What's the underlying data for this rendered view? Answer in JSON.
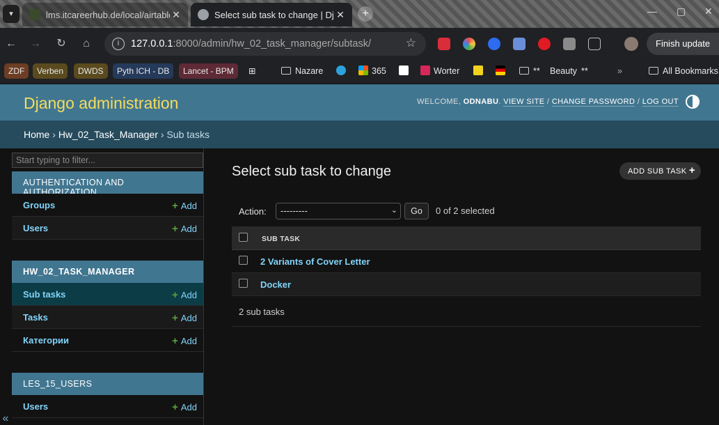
{
  "browser": {
    "tabs": [
      {
        "title": "lms.itcareerhub.de/local/airtable",
        "active": false
      },
      {
        "title": "Select sub task to change | Django",
        "active": true
      }
    ],
    "address": {
      "host": "127.0.0.1",
      "rest": ":8000/admin/hw_02_task_manager/subtask/"
    },
    "finish_update": "Finish update",
    "bookmarks": [
      "ZDF",
      "Verben",
      "DWDS",
      "Pyth ICH - DB",
      "Lancet - BPM",
      "Nazare",
      "365",
      "Worter",
      "**",
      "Beauty",
      "**",
      "All Bookmarks"
    ]
  },
  "header": {
    "brand": "Django administration",
    "welcome": "Welcome,",
    "username": "odnabu",
    "view_site": "View site",
    "change_password": "Change password",
    "log_out": "Log out"
  },
  "breadcrumbs": {
    "home": "Home",
    "app": "Hw_02_Task_Manager",
    "current": "Sub tasks"
  },
  "sidebar": {
    "filter_placeholder": "Start typing to filter...",
    "add_label": "Add",
    "modules": [
      {
        "caption": "Authentication and Authorization",
        "items": [
          "Groups",
          "Users"
        ]
      },
      {
        "caption": "HW_02_TASK_MANAGER",
        "items": [
          "Sub tasks",
          "Tasks",
          "Категории"
        ]
      },
      {
        "caption": "LES_15_USERS",
        "items": [
          "Users"
        ]
      }
    ]
  },
  "main": {
    "title": "Select sub task to change",
    "add_button": "Add sub task",
    "action_label": "Action:",
    "action_selected": "---------",
    "go_label": "Go",
    "counter": "0 of 2 selected",
    "column_header": "Sub task",
    "rows": [
      "2 Variants of Cover Letter",
      "Docker"
    ],
    "paginator": "2 sub tasks"
  }
}
